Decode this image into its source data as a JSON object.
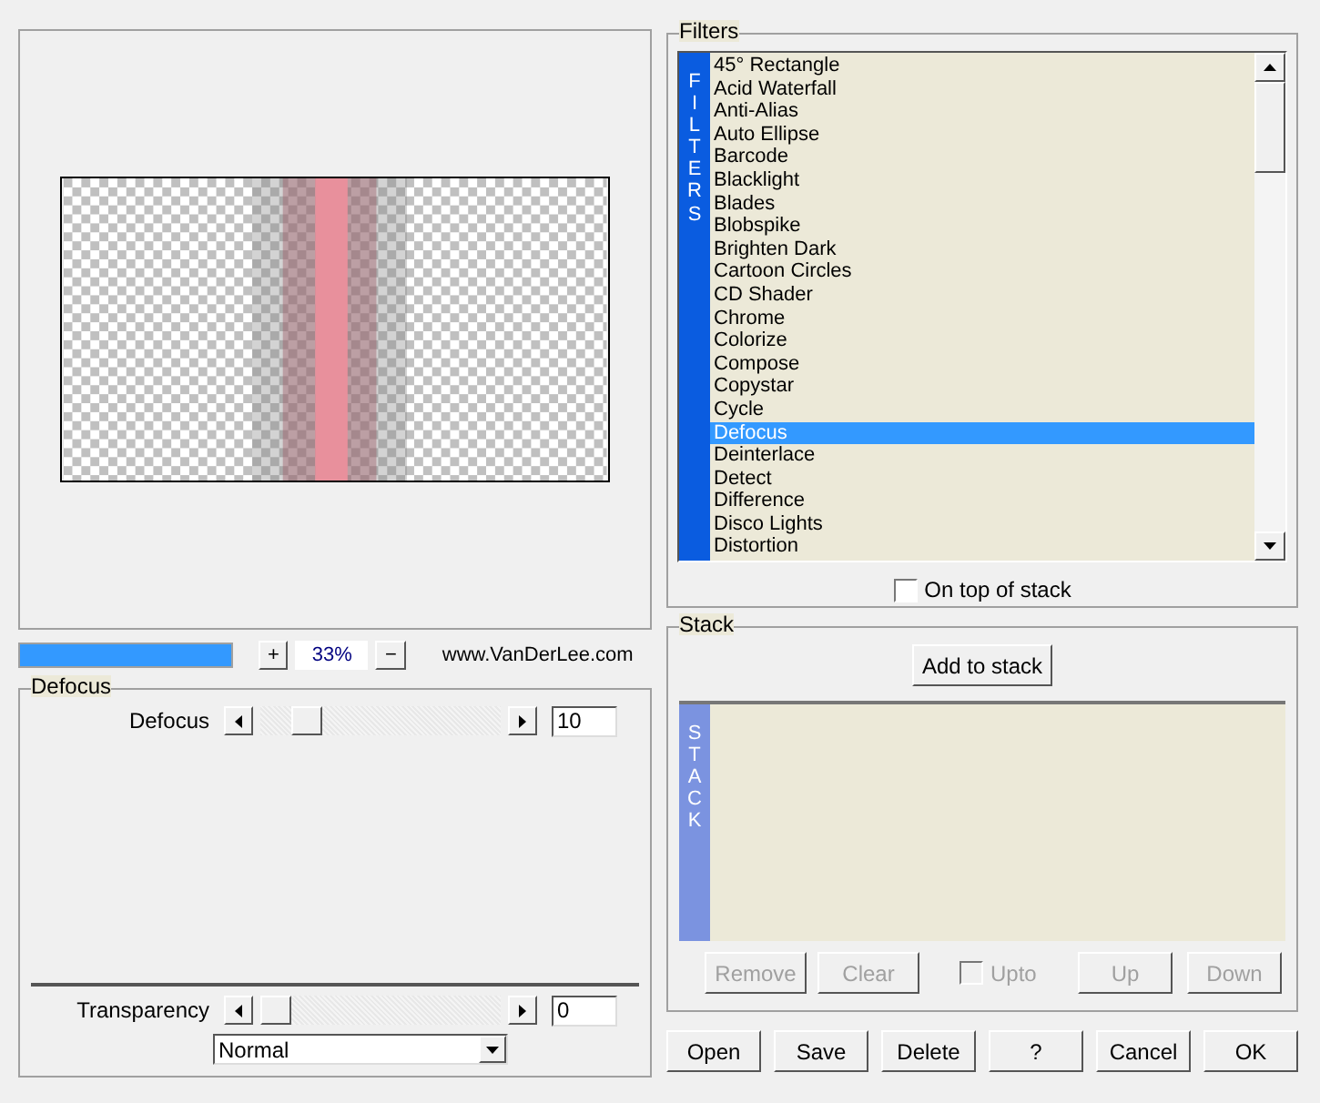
{
  "preview": {
    "progress": {
      "level": 1
    },
    "zoom_in": "+",
    "zoom": "33%",
    "zoom_out": "−",
    "link": "www.VanDerLee.com"
  },
  "settings": {
    "title": "Defocus",
    "sliders": [
      {
        "label": "Defocus",
        "level": 0.15,
        "value": "10"
      }
    ],
    "transparency": {
      "label": "Transparency",
      "level": 0,
      "value": "0"
    },
    "blend_mode": "Normal"
  },
  "filters": {
    "title": "Filters",
    "side_label": "FILTERS",
    "items": [
      {
        "label": "45° Rectangle",
        "selected": false
      },
      {
        "label": "Acid Waterfall",
        "selected": false
      },
      {
        "label": "Anti-Alias",
        "selected": false
      },
      {
        "label": "Auto Ellipse",
        "selected": false
      },
      {
        "label": "Barcode",
        "selected": false
      },
      {
        "label": "Blacklight",
        "selected": false
      },
      {
        "label": "Blades",
        "selected": false
      },
      {
        "label": "Blobspike",
        "selected": false
      },
      {
        "label": "Brighten Dark",
        "selected": false
      },
      {
        "label": "Cartoon Circles",
        "selected": false
      },
      {
        "label": "CD Shader",
        "selected": false
      },
      {
        "label": "Chrome",
        "selected": false
      },
      {
        "label": "Colorize",
        "selected": false
      },
      {
        "label": "Compose",
        "selected": false
      },
      {
        "label": "Copystar",
        "selected": false
      },
      {
        "label": "Cycle",
        "selected": false
      },
      {
        "label": "Defocus",
        "selected": true
      },
      {
        "label": "Deinterlace",
        "selected": false
      },
      {
        "label": "Detect",
        "selected": false
      },
      {
        "label": "Difference",
        "selected": false
      },
      {
        "label": "Disco Lights",
        "selected": false
      },
      {
        "label": "Distortion",
        "selected": false
      }
    ],
    "on_top_of_stack": {
      "label": "On top of stack",
      "checked": false
    }
  },
  "stack": {
    "title": "Stack",
    "add_button": "Add to stack",
    "side_label": "STACK",
    "buttons": [
      {
        "label": "Remove",
        "disabled": true
      },
      {
        "label": "Clear",
        "disabled": true
      }
    ],
    "upto": {
      "label": "Upto",
      "checked": false,
      "disabled": true
    },
    "move_buttons": [
      {
        "label": "Up",
        "disabled": true
      },
      {
        "label": "Down",
        "disabled": true
      }
    ]
  },
  "footer_buttons": [
    "Open",
    "Save",
    "Delete",
    "?",
    "Cancel",
    "OK"
  ]
}
